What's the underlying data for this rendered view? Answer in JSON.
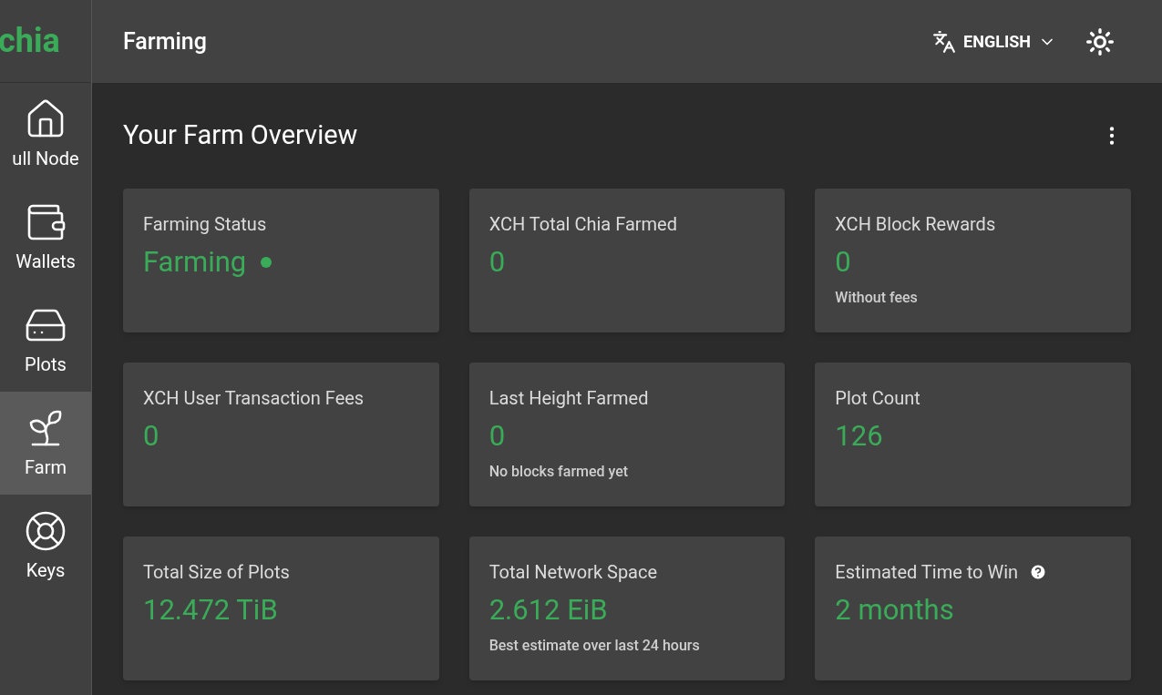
{
  "logo": "chia",
  "sidebar": {
    "items": [
      {
        "label": "ull Node",
        "selected": false
      },
      {
        "label": "Wallets",
        "selected": false
      },
      {
        "label": "Plots",
        "selected": false
      },
      {
        "label": "Farm",
        "selected": true
      },
      {
        "label": "Keys",
        "selected": false
      }
    ]
  },
  "header": {
    "title": "Farming",
    "language": "ENGLISH"
  },
  "overview": {
    "title": "Your Farm Overview",
    "cards": [
      {
        "title": "Farming Status",
        "value": "Farming",
        "status_dot": true
      },
      {
        "title": "XCH Total Chia Farmed",
        "value": "0"
      },
      {
        "title": "XCH Block Rewards",
        "value": "0",
        "note": "Without fees"
      },
      {
        "title": "XCH User Transaction Fees",
        "value": "0"
      },
      {
        "title": "Last Height Farmed",
        "value": "0",
        "note": "No blocks farmed yet"
      },
      {
        "title": "Plot Count",
        "value": "126"
      },
      {
        "title": "Total Size of Plots",
        "value": "12.472 TiB"
      },
      {
        "title": "Total Network Space",
        "value": "2.612 EiB",
        "note": "Best estimate over last 24 hours"
      },
      {
        "title": "Estimated Time to Win",
        "value": "2 months",
        "help": true
      }
    ]
  }
}
